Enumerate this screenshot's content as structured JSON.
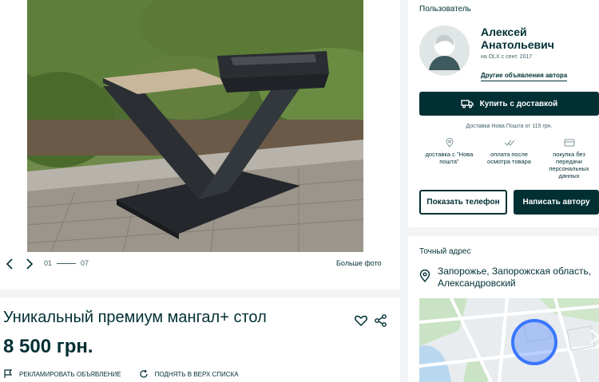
{
  "gallery": {
    "current": "01",
    "total": "07",
    "big_photo_label": "Больше фото"
  },
  "ad": {
    "title": "Уникальный премиум мангал+ стол",
    "price": "8 500 грн.",
    "report_label": "Рекламировать объявление",
    "bump_label": "Поднять в верх списка"
  },
  "user": {
    "header": "Пользователь",
    "name": "Алексей Анатольевич",
    "since": "на OLX с сент. 2017",
    "other_ads_label": "Другие объявления автора",
    "buy_label": "Купить с доставкой",
    "delivery_note": "Доставка Нова Пошта от 115 грн.",
    "features": [
      {
        "icon": "pin-icon",
        "label": "доставка с \"Нова пошта\""
      },
      {
        "icon": "check-icon",
        "label": "оплата после осмотра товара"
      },
      {
        "icon": "card-icon",
        "label": "покупка без передачи персональных данных"
      }
    ],
    "phone_label": "Показать телефон",
    "write_label": "Написать автору"
  },
  "address": {
    "header": "Точный адрес",
    "text": "Запорожье, Запорожская область, Александровский"
  },
  "colors": {
    "primary": "#002f34",
    "background": "#f2f4f5",
    "map_marker": "#3a77ff"
  }
}
